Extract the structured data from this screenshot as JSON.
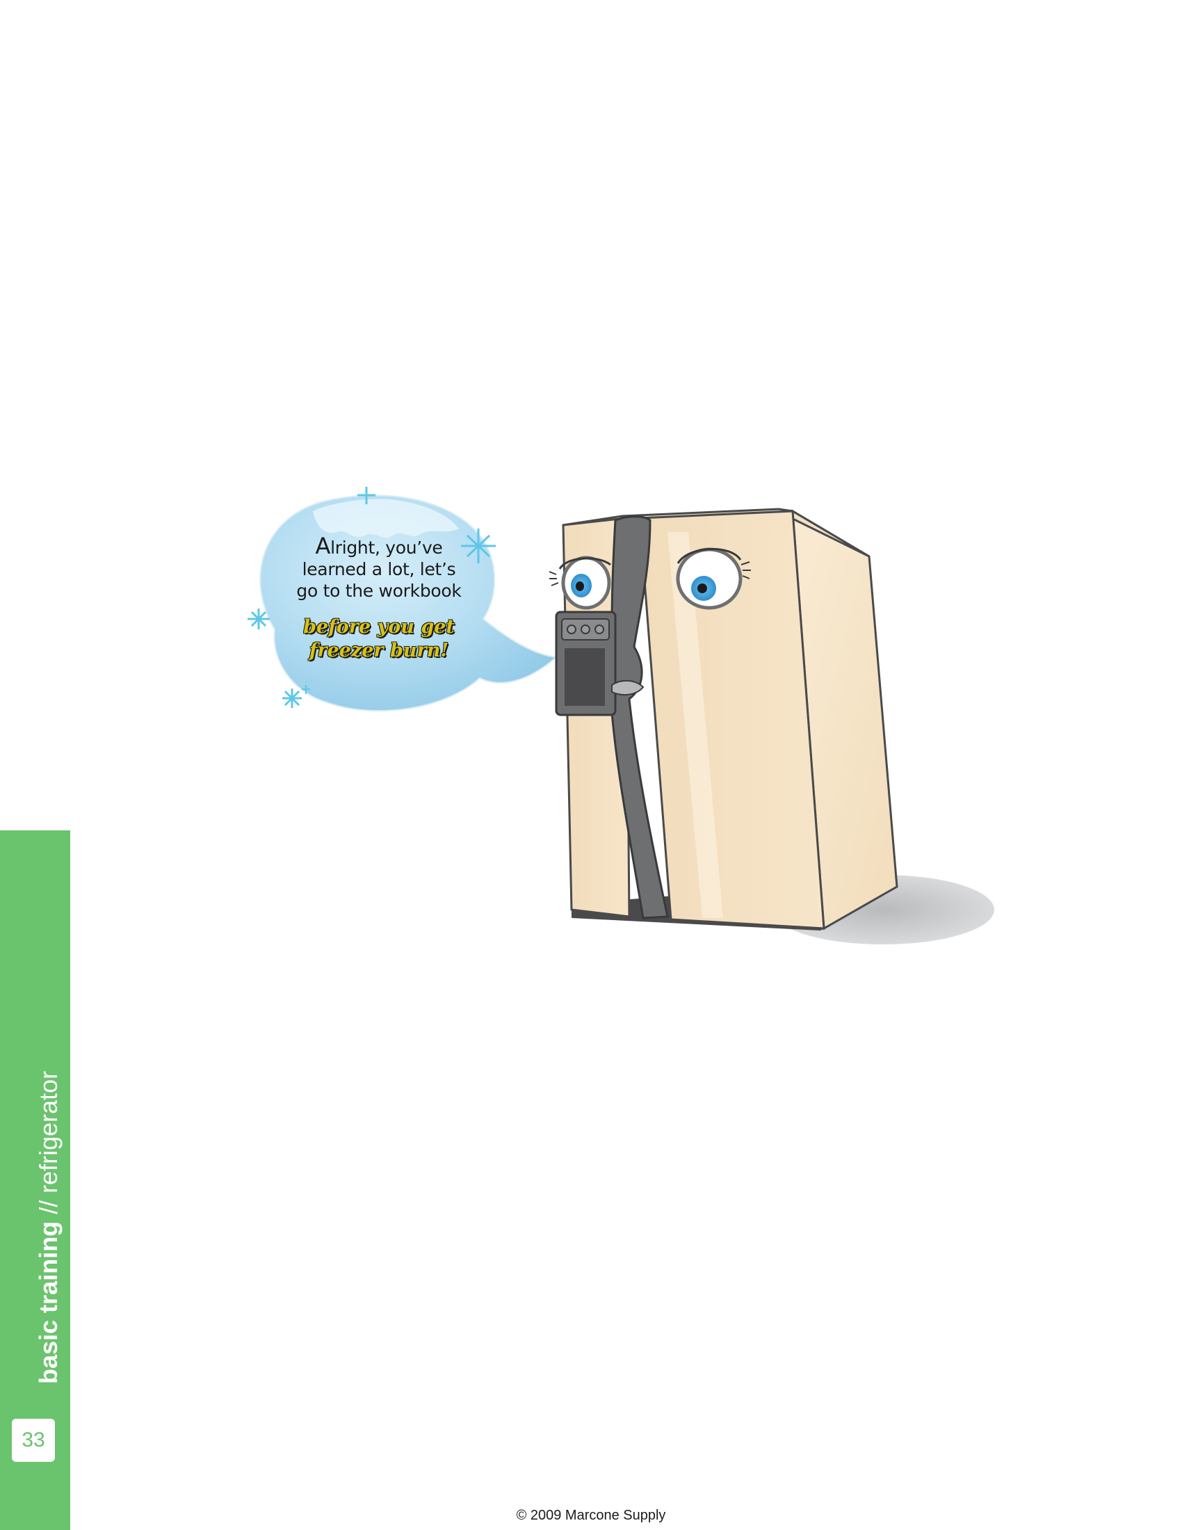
{
  "side_tab": {
    "title_bold": "basic training",
    "title_rest": " // refrigerator",
    "page_number": "33",
    "color": "#6ac36d"
  },
  "speech_bubble": {
    "line1_cap": "A",
    "line1_rest": "lright, you’ve",
    "line2": "learned a lot, let’s",
    "line3": "go to the workbook",
    "emphasis_line1": "before you get",
    "emphasis_line2": "freezer burn!"
  },
  "illustration": {
    "subject": "cartoon side-by-side refrigerator with face",
    "body_color": "#f6e3c6",
    "handle_color": "#6e6f71",
    "eye_color": "#3aa0dc",
    "bubble_color": "#a9d7ee",
    "sparkle_icons": [
      "sparkle-icon",
      "sparkle-icon",
      "sparkle-icon",
      "sparkle-icon",
      "sparkle-icon"
    ]
  },
  "footer": {
    "copyright": "© 2009 Marcone Supply"
  }
}
